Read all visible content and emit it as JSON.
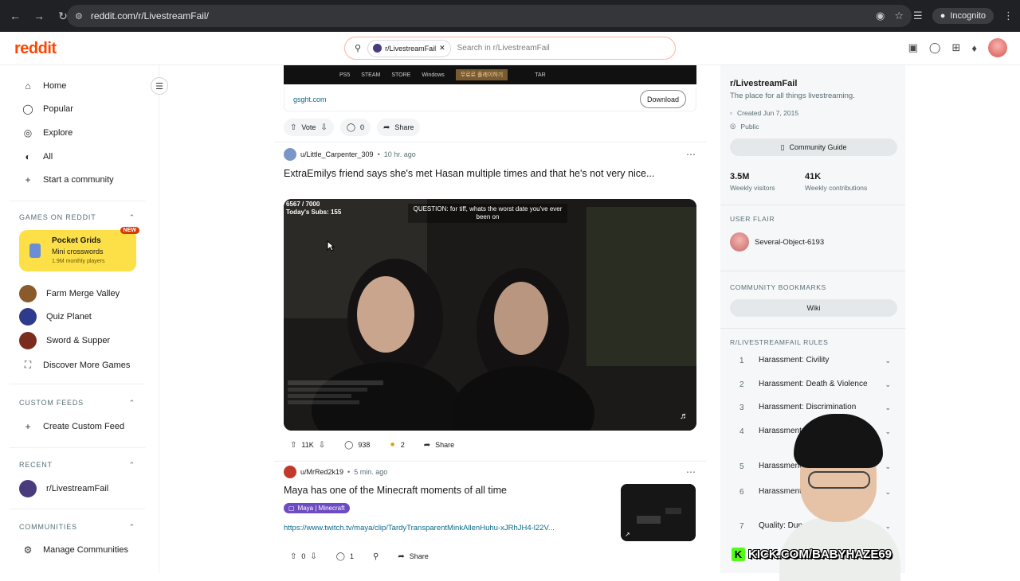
{
  "browser": {
    "url": "reddit.com/r/LivestreamFail/",
    "incognito_label": "Incognito"
  },
  "header": {
    "logo": "reddit",
    "search_chip": "r/LivestreamFail",
    "search_placeholder": "Search in r/LivestreamFail"
  },
  "sidebar": {
    "nav": [
      {
        "label": "Home",
        "icon": "home-icon"
      },
      {
        "label": "Popular",
        "icon": "popular-icon"
      },
      {
        "label": "Explore",
        "icon": "explore-icon"
      },
      {
        "label": "All",
        "icon": "all-icon"
      },
      {
        "label": "Start a community",
        "icon": "plus-icon"
      }
    ],
    "games_section": "GAMES ON REDDIT",
    "featured_game": {
      "title": "Pocket Grids",
      "subtitle": "Mini crosswords",
      "players": "1.9M monthly players",
      "badge": "NEW"
    },
    "games": [
      {
        "label": "Farm Merge Valley",
        "color": "#8a5a2b"
      },
      {
        "label": "Quiz Planet",
        "color": "#2e3a8c"
      },
      {
        "label": "Sword & Supper",
        "color": "#7a2d1e"
      },
      {
        "label": "Discover More Games",
        "color": ""
      }
    ],
    "custom_feeds_section": "CUSTOM FEEDS",
    "create_custom_feed": "Create Custom Feed",
    "recent_section": "RECENT",
    "recent": [
      {
        "label": "r/LivestreamFail"
      }
    ],
    "communities_section": "COMMUNITIES",
    "manage_communities": "Manage Communities"
  },
  "feed": {
    "ad": {
      "media_items": [
        "PS5",
        "STEAM",
        "STORE",
        "Windows",
        "무료로 플레이하기",
        "TAR"
      ],
      "domain": "gsght.com",
      "download_label": "Download",
      "vote_label": "Vote",
      "comments": "0",
      "share_label": "Share"
    },
    "posts": [
      {
        "user": "u/Little_Carpenter_309",
        "age": "10 hr. ago",
        "title": "ExtraEmilys friend says she's met Hasan multiple times and that he's not very nice...",
        "video_counter": "6567 / 7000",
        "video_subs": "Today's Subs: 155",
        "video_question": "QUESTION: for tiff, whats the worst date you've ever been on",
        "votes": "11K",
        "comments": "938",
        "awards": "2",
        "share_label": "Share"
      },
      {
        "user": "u/MrRed2k19",
        "age": "5 min. ago",
        "title": "Maya has one of the Minecraft moments of all time",
        "flair": "Maya | Minecraft",
        "url": "https://www.twitch.tv/maya/clip/TardyTransparentMinkAllenHuhu-xJRhJH4-l22V...",
        "votes": "0",
        "comments": "1",
        "share_label": "Share"
      }
    ]
  },
  "right_sidebar": {
    "name": "r/LivestreamFail",
    "description": "The place for all things livestreaming.",
    "created": "Created Jun 7, 2015",
    "visibility": "Public",
    "guide_label": "Community Guide",
    "stats": [
      {
        "value": "3.5M",
        "label": "Weekly visitors"
      },
      {
        "value": "41K",
        "label": "Weekly contributions"
      }
    ],
    "user_flair_section": "USER FLAIR",
    "user_flair_name": "Several-Object-6193",
    "bookmarks_section": "COMMUNITY BOOKMARKS",
    "wiki_label": "Wiki",
    "rules_section": "R/LIVESTREAMFAIL RULES",
    "rules": [
      {
        "n": "1",
        "text": "Harassment: Civility"
      },
      {
        "n": "2",
        "text": "Harassment: Death & Violence"
      },
      {
        "n": "3",
        "text": "Harassment: Discrimination"
      },
      {
        "n": "4",
        "text": "Harassment: Allegations"
      },
      {
        "n": "5",
        "text": "Harassment"
      },
      {
        "n": "6",
        "text": "Harassment: Content"
      },
      {
        "n": "7",
        "text": "Quality: Dup"
      }
    ]
  },
  "overlay": {
    "kick_text": "KICK.COM/BABYHAZE69"
  },
  "colors": {
    "reddit_orange": "#ff4500",
    "link_blue": "#0a6a8a",
    "games_yellow": "#fde047",
    "kick_green": "#53fc18"
  }
}
